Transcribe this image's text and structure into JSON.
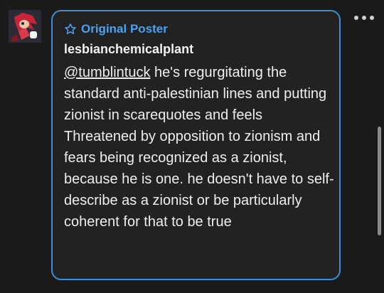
{
  "post": {
    "badge_label": "Original Poster",
    "badge_icon": "star-outline-icon",
    "username": "lesbianchemicalplant",
    "mention": "@tumblintuck",
    "body": " he's regurgitating the standard anti-palestinian lines and putting zionist in scarequotes and feels Threatened by opposition to zionism  and fears being recognized as a zionist, because he is one. he doesn't have to self-describe as a zionist or be particularly coherent for that to be true"
  },
  "colors": {
    "accent": "#3b8fd6",
    "badge": "#4aa3f0",
    "background": "#1a1a1a",
    "card": "#222222"
  }
}
